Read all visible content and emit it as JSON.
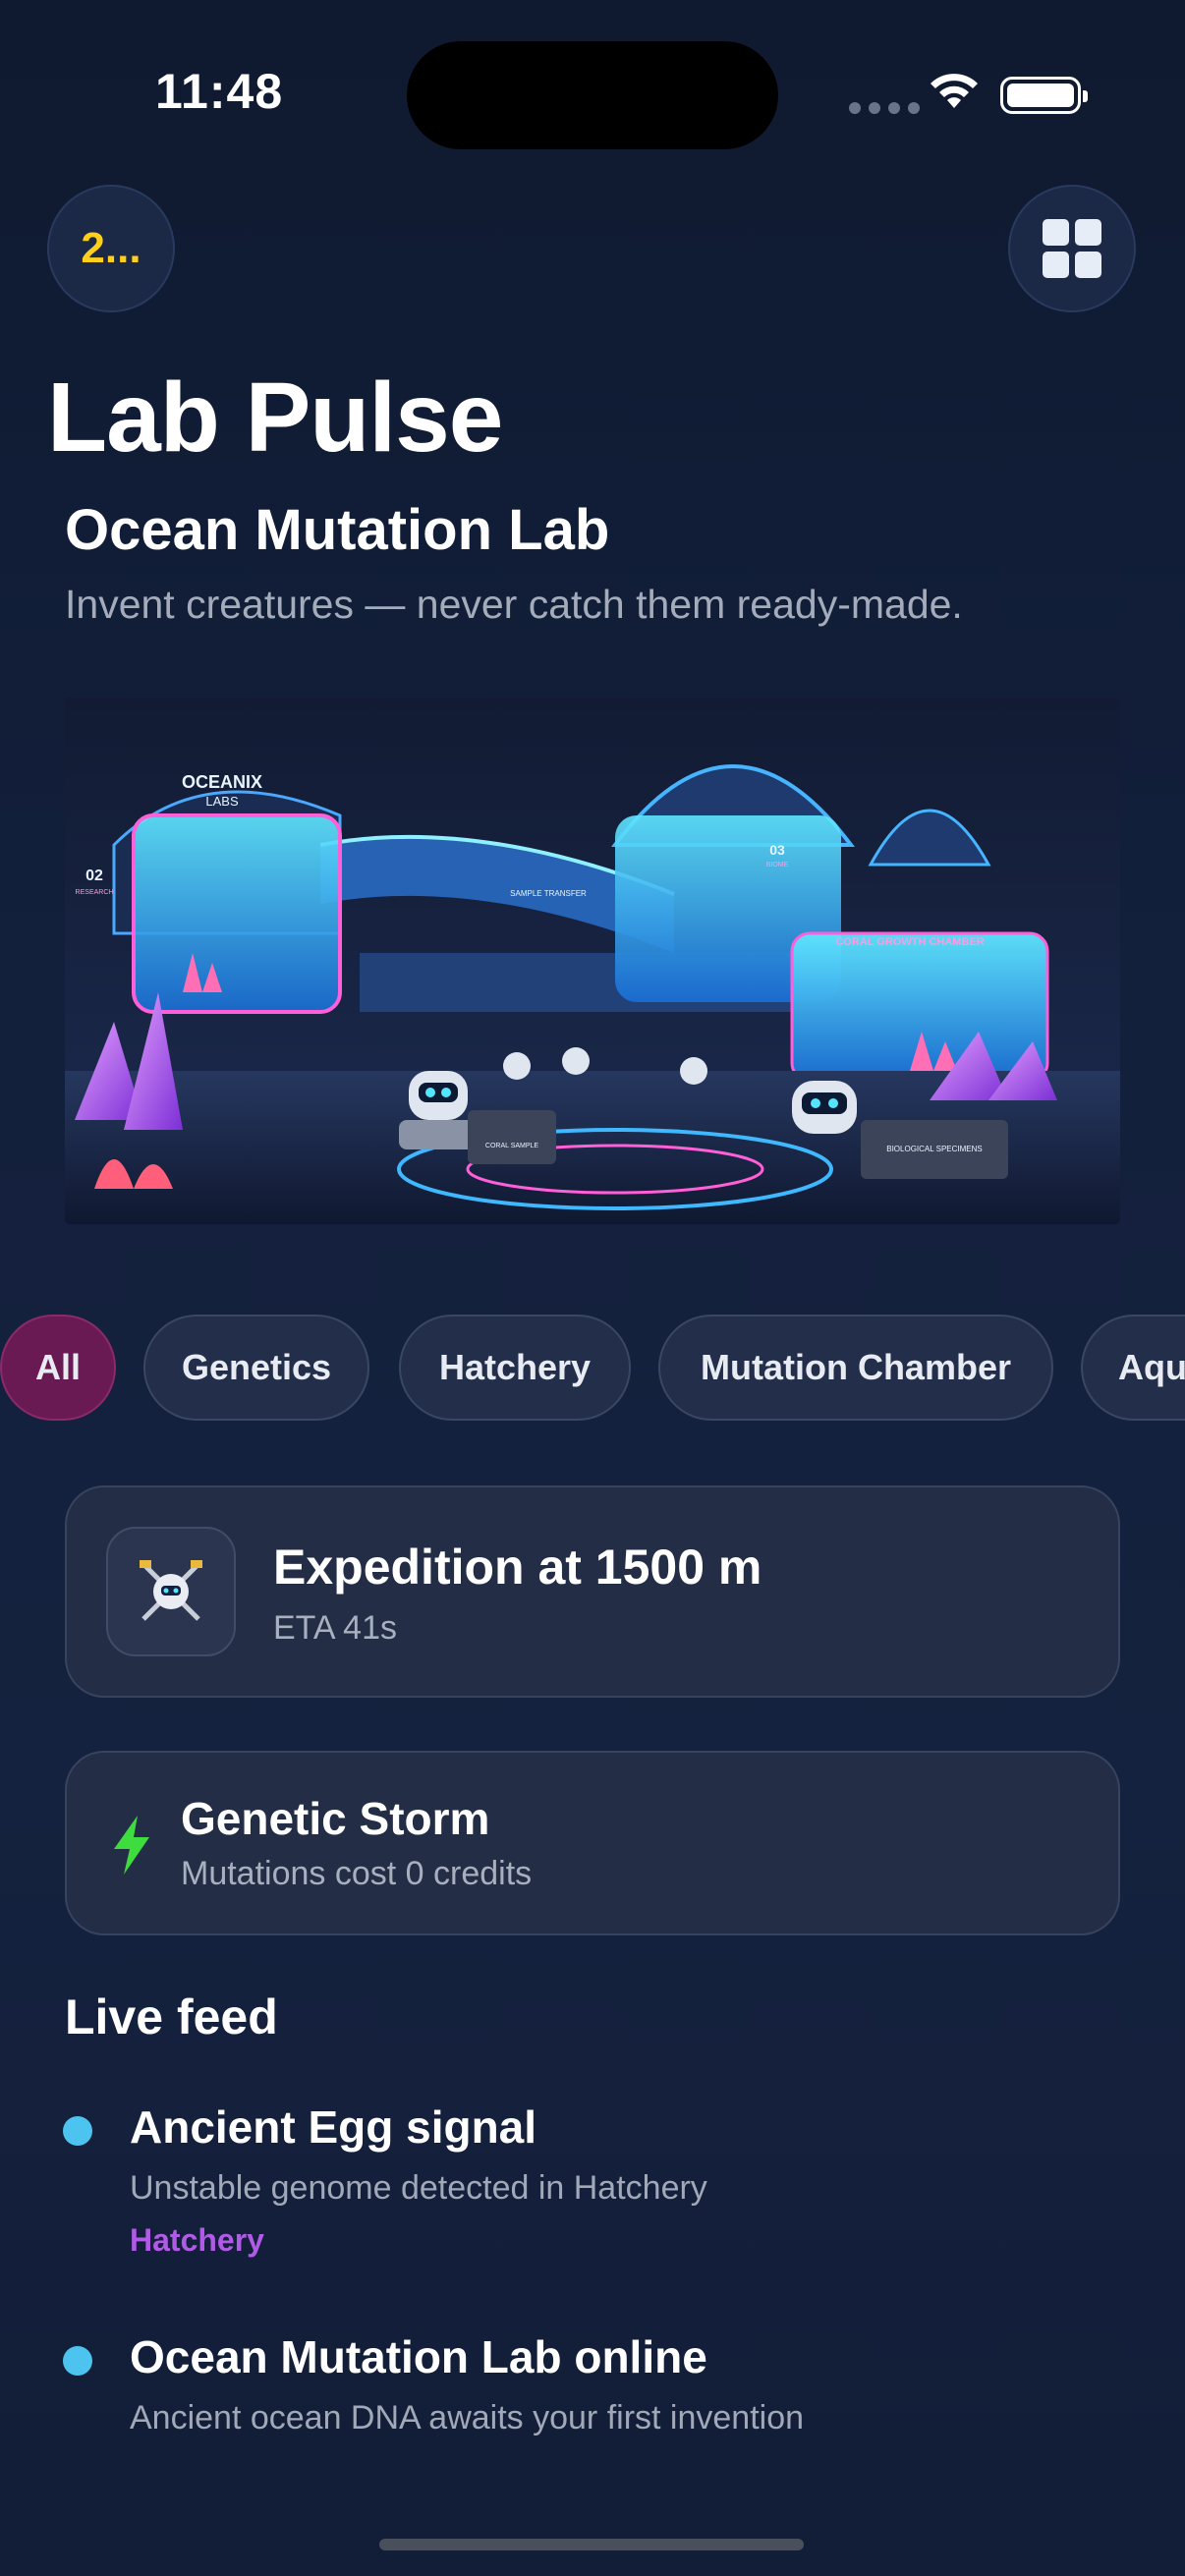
{
  "status_bar": {
    "time": "11:48"
  },
  "header": {
    "badge_label": "2...",
    "badge_color": "#ffcf1a",
    "menu_icon": "grid-icon",
    "title": "Lab Pulse"
  },
  "lab": {
    "name": "Ocean Mutation Lab",
    "tagline": "Invent creatures — never catch them ready-made.",
    "hero_image": {
      "sign_main": "OCEANIX",
      "sign_sub": "LABS",
      "panel_left_number": "02",
      "panel_left_label": "RESEARCH",
      "panel_right_number": "03",
      "panel_right_label": "BIOME",
      "sign_transfer": "SAMPLE TRANSFER",
      "sign_chamber": "CORAL GROWTH CHAMBER",
      "crate_left": "CORAL SAMPLE",
      "crate_right": "BIOLOGICAL SPECIMENS"
    }
  },
  "filters": {
    "chips": [
      {
        "label": "All",
        "active": true
      },
      {
        "label": "Genetics",
        "active": false
      },
      {
        "label": "Hatchery",
        "active": false
      },
      {
        "label": "Mutation Chamber",
        "active": false
      },
      {
        "label": "Aqu",
        "active": false
      }
    ]
  },
  "expedition": {
    "icon": "robot-diver-icon",
    "title": "Expedition at 1500 m",
    "eta": "ETA 41s"
  },
  "event": {
    "icon": "lightning-bolt-icon",
    "icon_color": "#3fdc3f",
    "title": "Genetic Storm",
    "subtitle": "Mutations cost 0 credits"
  },
  "live_feed": {
    "title": "Live feed",
    "items": [
      {
        "title": "Ancient Egg signal",
        "subtitle": "Unstable genome detected in Hatchery",
        "tag": "Hatchery"
      },
      {
        "title": "Ocean Mutation Lab online",
        "subtitle": "Ancient ocean DNA awaits your first invention"
      }
    ]
  },
  "colors": {
    "background": "#13203c",
    "card": "#232d46",
    "accent_active_chip": "#6a1a53",
    "feed_dot": "#4cc4ef",
    "tag": "#b05be6"
  }
}
